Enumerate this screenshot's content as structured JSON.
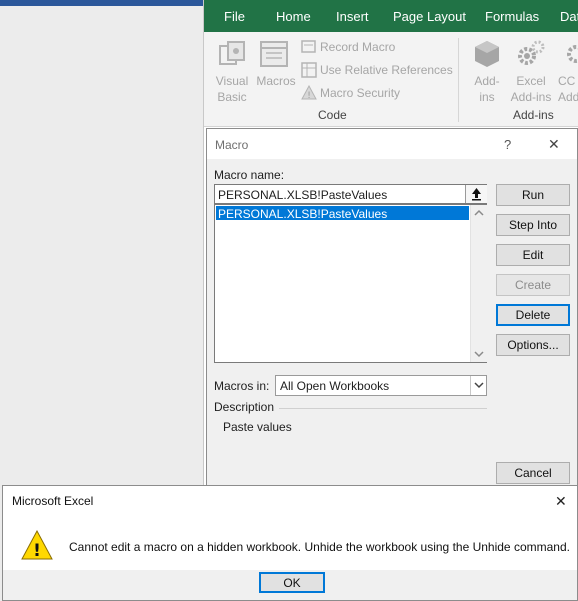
{
  "ribbon": {
    "tabs": [
      "File",
      "Home",
      "Insert",
      "Page Layout",
      "Formulas",
      "Dat"
    ],
    "code_group": {
      "visual_basic": "Visual",
      "visual_basic_2": "Basic",
      "macros": "Macros",
      "record_macro": "Record Macro",
      "use_relative": "Use Relative References",
      "macro_security": "Macro Security",
      "label": "Code"
    },
    "addins_group": {
      "addins": "Add-",
      "addins_2": "ins",
      "excel_addins": "Excel",
      "excel_addins_2": "Add-ins",
      "com_addins": "CC",
      "com_addins_2": "Add",
      "label": "Add-ins"
    }
  },
  "macro_dialog": {
    "title": "Macro",
    "help_glyph": "?",
    "close_glyph": "✕",
    "macro_name_label": "Macro name:",
    "macro_name_value": "PERSONAL.XLSB!PasteValues",
    "list_items": [
      "PERSONAL.XLSB!PasteValues"
    ],
    "buttons": {
      "run": "Run",
      "step_into": "Step Into",
      "edit": "Edit",
      "create": "Create",
      "delete": "Delete",
      "options": "Options...",
      "cancel": "Cancel"
    },
    "macros_in_label": "Macros in:",
    "macros_in_value": "All Open Workbooks",
    "description_label": "Description",
    "description_text": "Paste values"
  },
  "message_box": {
    "title": "Microsoft Excel",
    "close_glyph": "✕",
    "message": "Cannot edit a macro on a hidden workbook. Unhide the workbook using the Unhide command.",
    "ok_label": "OK",
    "warning_glyph": "!"
  },
  "colors": {
    "excel_green": "#217346",
    "selection_blue": "#0078d7",
    "word_blue": "#2b579a",
    "warning_yellow": "#ffd800"
  }
}
